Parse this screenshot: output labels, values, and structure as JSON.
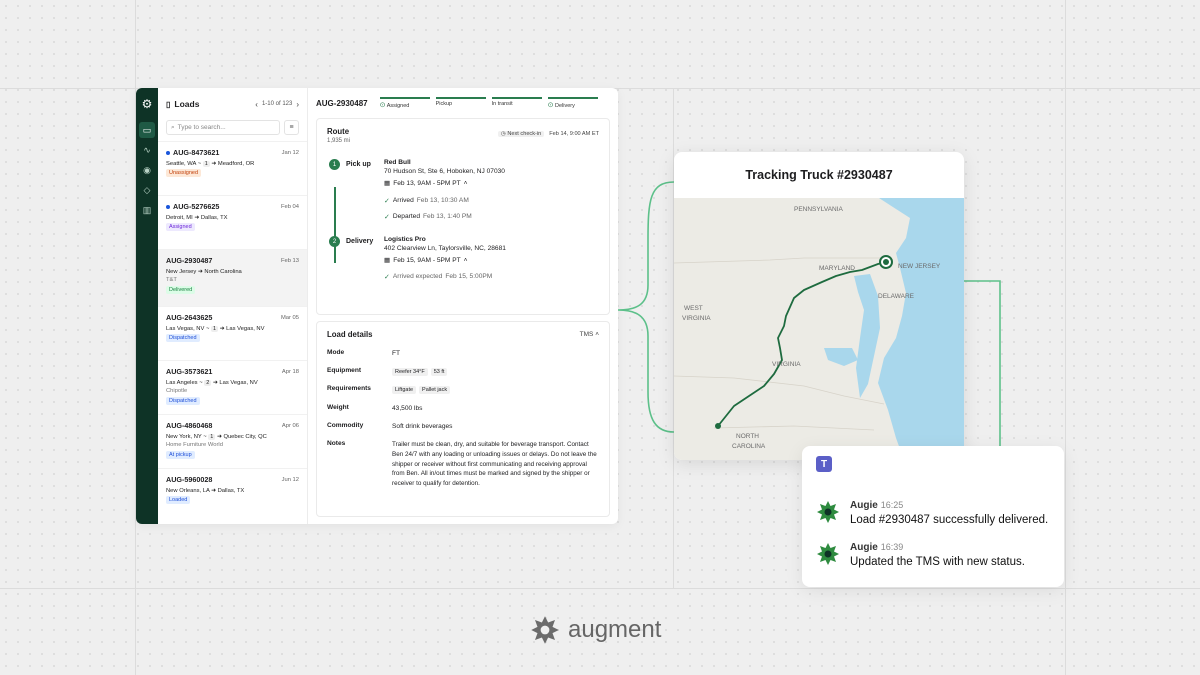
{
  "colors": {
    "brand_green": "#2a7d4f",
    "rail": "#0e3326",
    "teams": "#5b5fc7"
  },
  "list": {
    "title": "Loads",
    "pagination": "1-10 of 123",
    "search_placeholder": "Type to search...",
    "items": [
      {
        "id": "AUG-8473621",
        "date": "Jan 12",
        "from": "Seattle, WA",
        "stops": "1",
        "to": "Meadford, OR",
        "customer": "",
        "status": "Unassigned",
        "unread": true
      },
      {
        "id": "AUG-5276625",
        "date": "Feb 04",
        "from": "Detroit, MI",
        "stops": "",
        "to": "Dallas, TX",
        "customer": "",
        "status": "Assigned",
        "unread": true
      },
      {
        "id": "AUG-2930487",
        "date": "Feb 13",
        "from": "New Jersey",
        "stops": "",
        "to": "North Carolina",
        "customer": "T&T",
        "status": "Delivered",
        "unread": false
      },
      {
        "id": "AUG-2643625",
        "date": "Mar 05",
        "from": "Las Vegas, NV",
        "stops": "1",
        "to": "Las Vegas, NV",
        "customer": "",
        "status": "Dispatched",
        "unread": false
      },
      {
        "id": "AUG-3573621",
        "date": "Apr 18",
        "from": "Las Angeles",
        "stops": "2",
        "to": "Las Vegas, NV",
        "customer": "Chipotle",
        "status": "Dispatched",
        "unread": false
      },
      {
        "id": "AUG-4860468",
        "date": "Apr 06",
        "from": "New York, NY",
        "stops": "1",
        "to": "Quebec City, QC",
        "customer": "Home Furniture World",
        "status": "At pickup",
        "unread": false
      },
      {
        "id": "AUG-5960028",
        "date": "Jun 12",
        "from": "New Orleans, LA",
        "stops": "",
        "to": "Dallas, TX",
        "customer": "",
        "status": "Loaded",
        "unread": false
      }
    ]
  },
  "detail": {
    "load_id": "AUG-2930487",
    "steps": [
      "Assigned",
      "Pickup",
      "In transit",
      "Delivery"
    ],
    "route": {
      "title": "Route",
      "distance": "1,935 mi",
      "next_checkin_label": "Next check-in",
      "next_checkin": "Feb 14, 9:00 AM ET",
      "pickup": {
        "num": "1",
        "label": "Pick up",
        "name": "Red Bull",
        "address": "70 Hudson St, Ste 6, Hoboken, NJ 07030",
        "window": "Feb 13, 9AM - 5PM PT",
        "arrived_label": "Arrived",
        "arrived": "Feb 13, 10:30 AM",
        "departed_label": "Departed",
        "departed": "Feb 13, 1:40 PM"
      },
      "delivery": {
        "num": "2",
        "label": "Delivery",
        "name": "Logistics Pro",
        "address": "402 Clearview Ln, Taylorsville, NC, 28681",
        "window": "Feb 15, 9AM - 5PM PT",
        "arrived_label": "Arrived expected",
        "arrived": "Feb 15, 5:00PM"
      }
    },
    "load_details": {
      "title": "Load details",
      "source": "TMS",
      "mode_label": "Mode",
      "mode": "FT",
      "equipment_label": "Equipment",
      "equipment": [
        "Reefer 34°F",
        "53 ft"
      ],
      "requirements_label": "Requirements",
      "requirements": [
        "Liftgate",
        "Pallet jack"
      ],
      "weight_label": "Weight",
      "weight": "43,500 lbs",
      "commodity_label": "Commodity",
      "commodity": "Soft drink beverages",
      "notes_label": "Notes",
      "notes": "Trailer must be clean, dry, and suitable for beverage transport. Contact Ben 24/7 with any loading or unloading issues or delays. Do not leave the shipper or receiver without first communicating and receiving approval from Ben. All in/out times must be marked and signed by the shipper or receiver to qualify for detention."
    }
  },
  "tracking": {
    "title": "Tracking Truck #2930487",
    "labels": {
      "pa": "PENNSYLVANIA",
      "nj": "NEW JERSEY",
      "md": "MARYLAND",
      "de": "DELAWARE",
      "wv1": "WEST",
      "wv2": "VIRGINIA",
      "va": "VIRGINIA",
      "nc1": "NORTH",
      "nc2": "CAROLINA"
    }
  },
  "teams": {
    "messages": [
      {
        "sender": "Augie",
        "time": "16:25",
        "text": "Load #2930487 successfully delivered."
      },
      {
        "sender": "Augie",
        "time": "16:39",
        "text": "Updated the TMS with new status."
      }
    ]
  },
  "brand": {
    "name": "augment"
  }
}
